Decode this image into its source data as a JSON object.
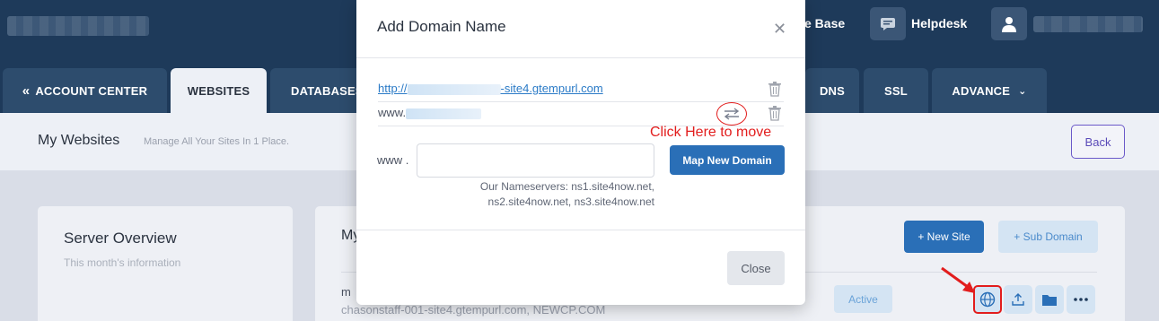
{
  "header": {
    "knowledge_base_label": "e Base",
    "helpdesk_label": "Helpdesk"
  },
  "nav": {
    "tabs": [
      {
        "label": "ACCOUNT CENTER"
      },
      {
        "label": "WEBSITES"
      },
      {
        "label": "DATABASES"
      },
      {
        "label": "DNS"
      },
      {
        "label": "SSL"
      },
      {
        "label": "ADVANCE"
      }
    ]
  },
  "subheader": {
    "title": "My Websites",
    "description": "Manage All Your Sites In 1 Place.",
    "back_label": "Back"
  },
  "server_overview": {
    "title": "Server Overview",
    "description": "This month's information"
  },
  "sites_card": {
    "title_partial": "My",
    "new_site_label": "+ New Site",
    "sub_domain_label": "+ Sub Domain",
    "row": {
      "name_partial": "m",
      "urls": "chasonstaff-001-site4.gtempurl.com, NEWCP.COM",
      "status": "Active"
    }
  },
  "modal": {
    "title": "Add Domain Name",
    "domains": [
      {
        "prefix": "http://",
        "suffix": "-site4.gtempurl.com"
      },
      {
        "prefix": "www.",
        "suffix": ""
      }
    ],
    "annotation": "Click Here to move",
    "www_label": "www .",
    "input_value": "",
    "map_button": "Map New Domain",
    "nameservers_line1": "Our Nameservers: ns1.site4now.net,",
    "nameservers_line2": "ns2.site4now.net, ns3.site4now.net",
    "close_label": "Close"
  },
  "colors": {
    "primary": "#2a6fb7",
    "nav_bg": "#1e3a5a",
    "annotation_red": "#e21d1d"
  }
}
